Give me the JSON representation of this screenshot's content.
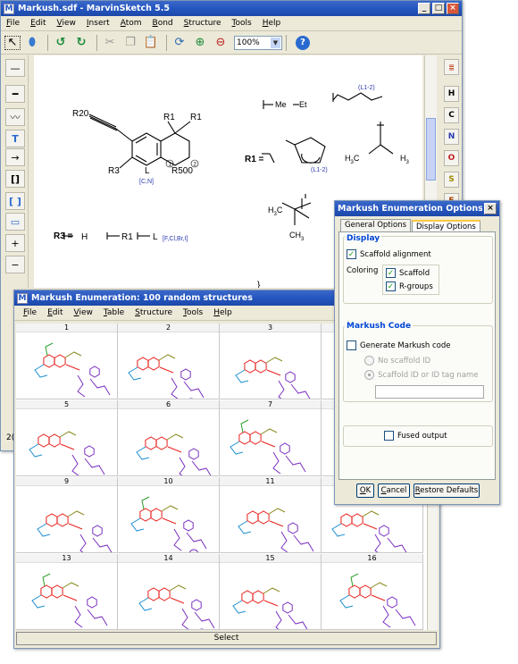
{
  "sketch": {
    "title": "Markush.sdf - MarvinSketch 5.5",
    "menu": [
      "File",
      "Edit",
      "View",
      "Insert",
      "Atom",
      "Bond",
      "Structure",
      "Tools",
      "Help"
    ],
    "zoom": "100%",
    "right_atoms": [
      "H",
      "C",
      "N",
      "O",
      "S"
    ],
    "status_left": "2("
  },
  "molecule": {
    "r20": "R20",
    "r1a": "R1",
    "r1b": "R1",
    "r3": "R3",
    "l": "L",
    "r500": "R500",
    "cn": "[C,N]",
    "c1": "1",
    "c2": "2",
    "me": "Me",
    "et": "Et",
    "l12a": "(L1-2)",
    "l12b": "(L1-2)",
    "r1def": "R1 =",
    "h3c": "H",
    "sub3": "3",
    "c": "C",
    "h3": "H",
    "r3def": "R3 =",
    "h": "H",
    "r1ref": "R1",
    "lref": "L",
    "halogens": "[F,Cl,Br,I]",
    "ch3": "CH",
    "ch3_sub": "3",
    "cut": "}"
  },
  "enum": {
    "title": "Markush Enumeration: 100 random structures",
    "menu": [
      "File",
      "Edit",
      "View",
      "Table",
      "Structure",
      "Tools",
      "Help"
    ],
    "cells": [
      "1",
      "2",
      "3",
      "4",
      "5",
      "6",
      "7",
      "8",
      "9",
      "10",
      "11",
      "12",
      "13",
      "14",
      "15",
      "16"
    ],
    "select": "Select"
  },
  "options": {
    "title": "Markush Enumeration Options",
    "tabs": [
      "General Options",
      "Display Options"
    ],
    "display_label": "Display",
    "scaffold_alignment": "Scaffold alignment",
    "coloring": "Coloring",
    "scaffold": "Scaffold",
    "rgroups": "R-groups",
    "code_label": "Markush Code",
    "generate_code": "Generate Markush code",
    "no_scaffold_id": "No scaffold ID",
    "scaffold_tag": "Scaffold ID or ID tag name",
    "fused": "Fused output",
    "ok": "OK",
    "cancel": "Cancel",
    "restore": "Restore Defaults"
  },
  "colors": {
    "title_blue": "#2456c0",
    "scaffold_red": "#e8201c",
    "rgroup_purple": "#7a2fc0",
    "rgroup_blue": "#1e90d0",
    "rgroup_olive": "#8a8a20",
    "rgroup_green": "#2aa02a",
    "label_blue": "#0046d5"
  }
}
